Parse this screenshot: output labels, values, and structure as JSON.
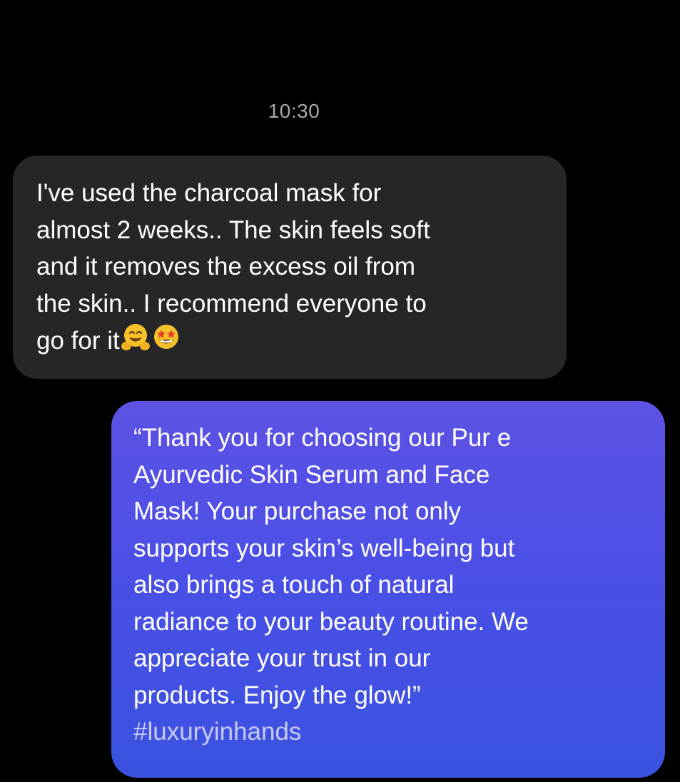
{
  "conversation": {
    "timestamp": "10:30",
    "incoming_message": {
      "text": "I've used the charcoal mask for\nalmost 2 weeks.. The skin feels soft\nand it removes the excess oil from\nthe skin.. I recommend everyone to\ngo for it",
      "emojis": [
        "hugging-face-emoji",
        "star-struck-emoji"
      ]
    },
    "outgoing_message": {
      "text": "“Thank you for choosing our Pur e\nAyurvedic Skin Serum and Face\nMask! Your purchase not only\nsupports your skin’s well-being but\nalso brings a touch of natural\nradiance to your beauty routine. We\nappreciate your trust in our\nproducts. Enjoy the glow!”",
      "hashtag": "#luxuryinhands"
    }
  },
  "colors": {
    "background": "#000000",
    "incoming_bubble": "#262629",
    "outgoing_bubble_top": "#5d52e4",
    "outgoing_bubble_bottom": "#3a52e0",
    "timestamp_text": "#a9a9ae"
  }
}
